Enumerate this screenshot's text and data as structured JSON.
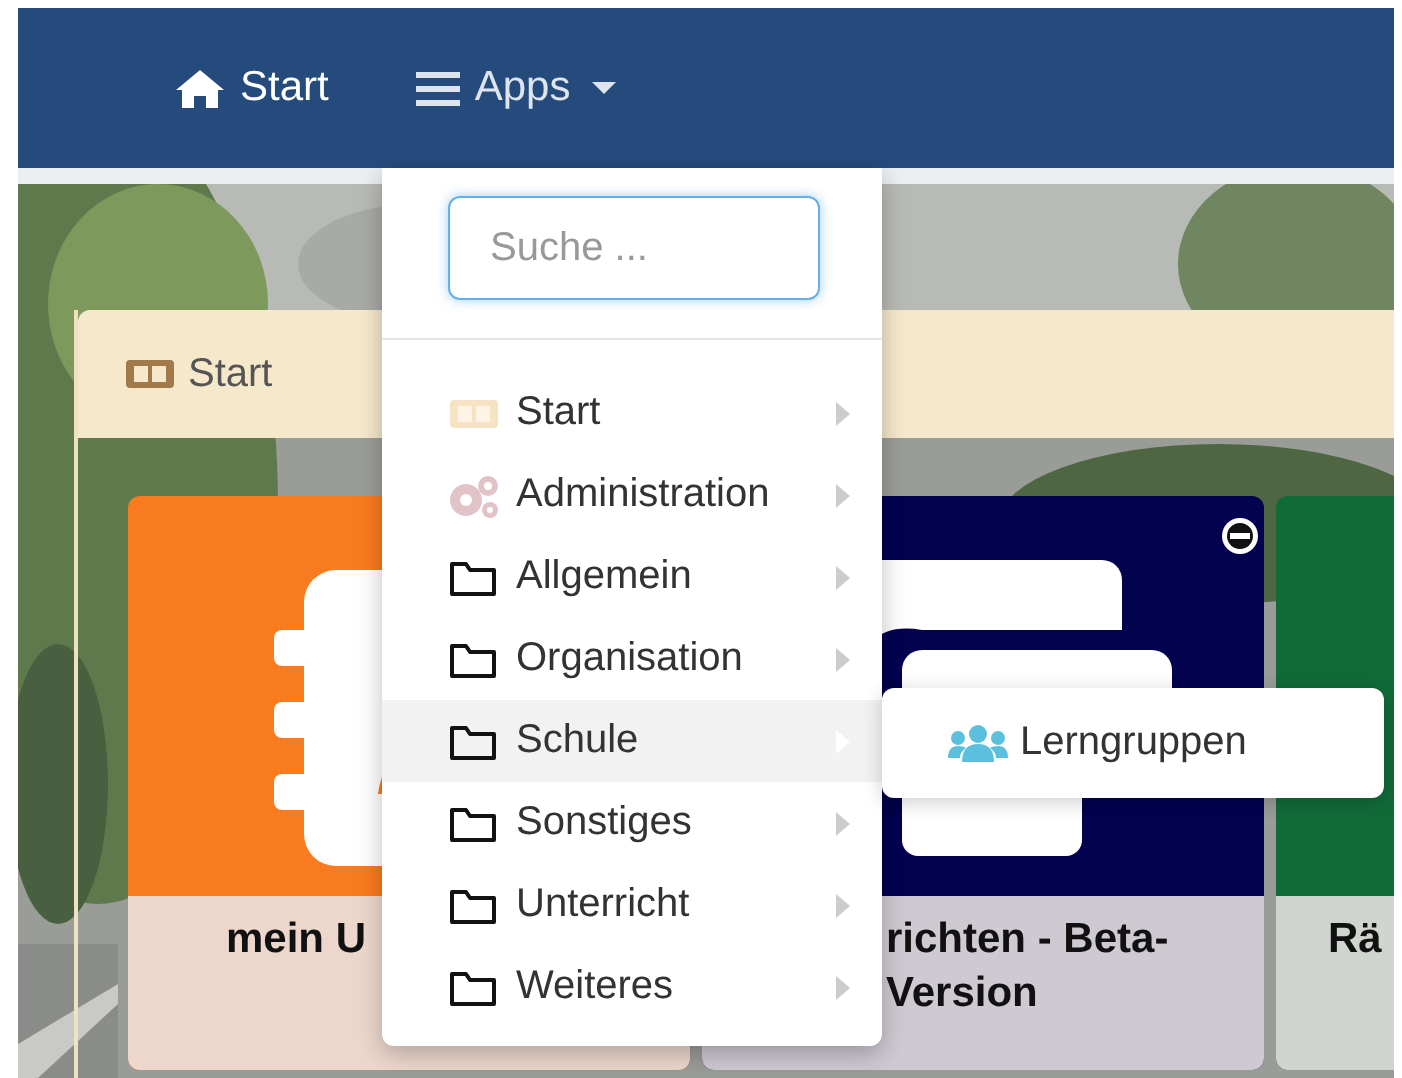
{
  "navbar": {
    "items": [
      {
        "kind": "home",
        "label": "Start"
      },
      {
        "kind": "apps",
        "label": "Apps",
        "expanded": true
      }
    ]
  },
  "panel": {
    "title": "Start",
    "tiles": [
      {
        "kind": "address-book",
        "color": "#f97b1f",
        "title_lines": [
          "mein U"
        ]
      },
      {
        "kind": "messages",
        "color": "#02024f",
        "title_lines": [
          "richten - Beta-",
          "Version"
        ],
        "removable": true
      },
      {
        "kind": "blank",
        "color": "#106b37",
        "title_lines": [
          "Rä"
        ]
      }
    ]
  },
  "apps_menu": {
    "search": {
      "placeholder": "Suche ..."
    },
    "items": [
      {
        "kind": "start",
        "label": "Start",
        "submenu": true,
        "selected": false
      },
      {
        "kind": "admin",
        "label": "Administration",
        "submenu": true,
        "selected": false
      },
      {
        "kind": "folder",
        "label": "Allgemein",
        "submenu": true,
        "selected": false
      },
      {
        "kind": "folder",
        "label": "Organisation",
        "submenu": true,
        "selected": false
      },
      {
        "kind": "folder",
        "label": "Schule",
        "submenu": true,
        "selected": true
      },
      {
        "kind": "folder",
        "label": "Sonstiges",
        "submenu": true,
        "selected": false
      },
      {
        "kind": "folder",
        "label": "Unterricht",
        "submenu": true,
        "selected": false
      },
      {
        "kind": "folder",
        "label": "Weiteres",
        "submenu": true,
        "selected": false
      }
    ],
    "submenu": {
      "items": [
        {
          "kind": "users",
          "label": "Lerngruppen"
        }
      ]
    }
  }
}
